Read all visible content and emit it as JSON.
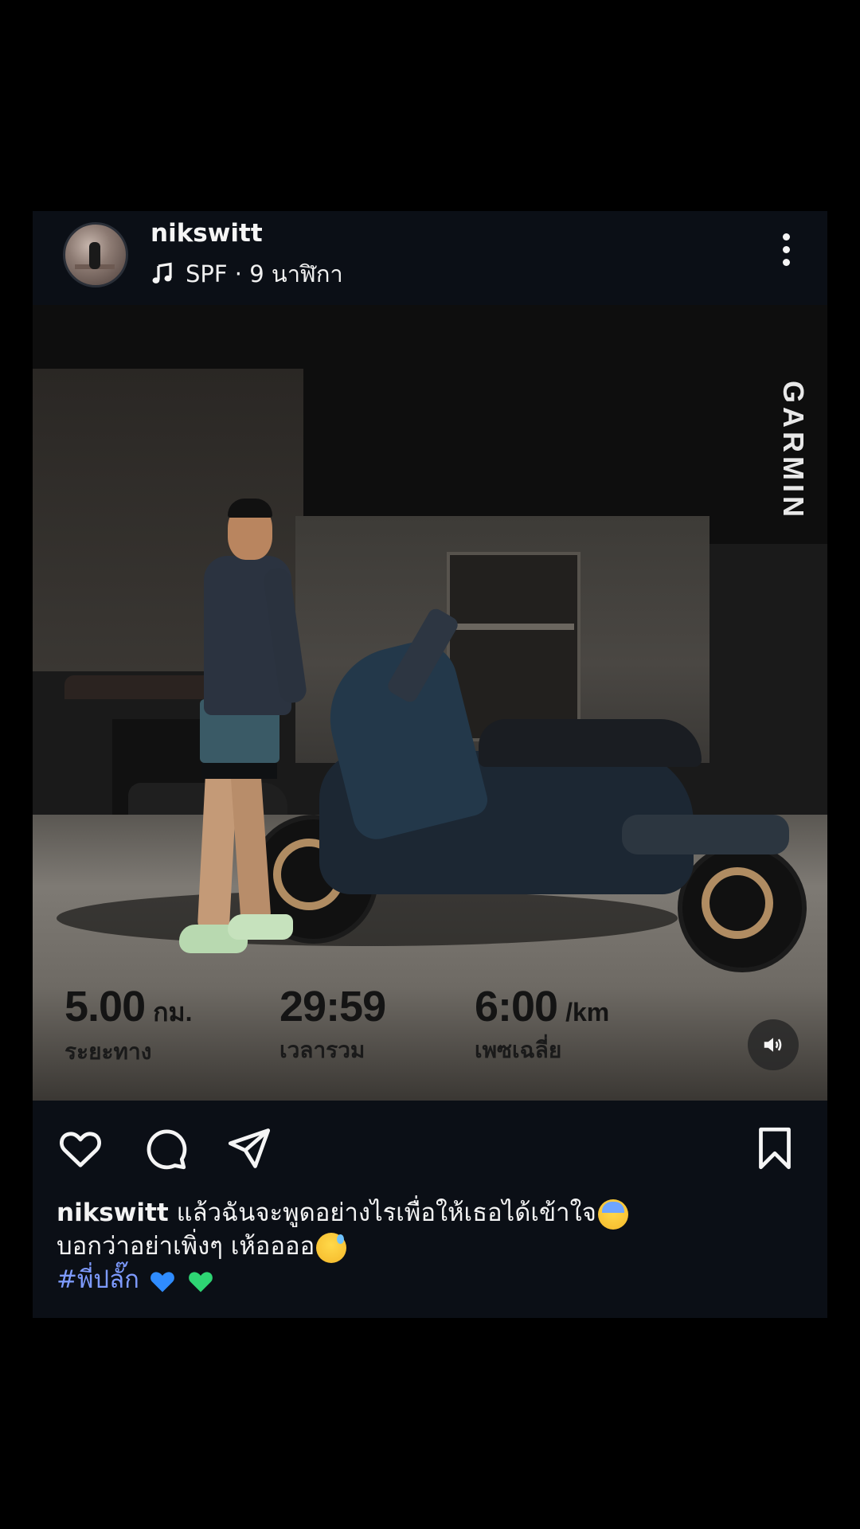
{
  "post": {
    "username": "nikswitt",
    "music_icon": "music-note-icon",
    "subtitle": "SPF · 9 นาฬิกา",
    "more_icon": "more-vertical-icon"
  },
  "photo": {
    "watermark": "GARMIN",
    "stats": [
      {
        "value": "5.00",
        "unit": "กม.",
        "label": "ระยะทาง"
      },
      {
        "value": "29:59",
        "unit": "",
        "label": "เวลารวม"
      },
      {
        "value": "6:00",
        "unit": "/km",
        "label": "เพซเฉลี่ย"
      }
    ],
    "volume_icon": "speaker-volume-icon"
  },
  "actions": {
    "like_icon": "heart-icon",
    "comment_icon": "comment-icon",
    "share_icon": "send-icon",
    "save_icon": "bookmark-icon"
  },
  "caption": {
    "username": "nikswitt",
    "line1": "แล้วฉันจะพูดอย่างไรเพื่อให้เธอได้เข้าใจ",
    "line2": "บอกว่าอย่าเพิ่งๆ เห้ออออ",
    "hashtag": "#พี่ปลั๊ก"
  },
  "colors": {
    "background": "#000000",
    "card": "#0b0f16",
    "hashtag": "#7e9bff",
    "blue_heart": "#2f8cff",
    "green_heart": "#2ed573"
  }
}
